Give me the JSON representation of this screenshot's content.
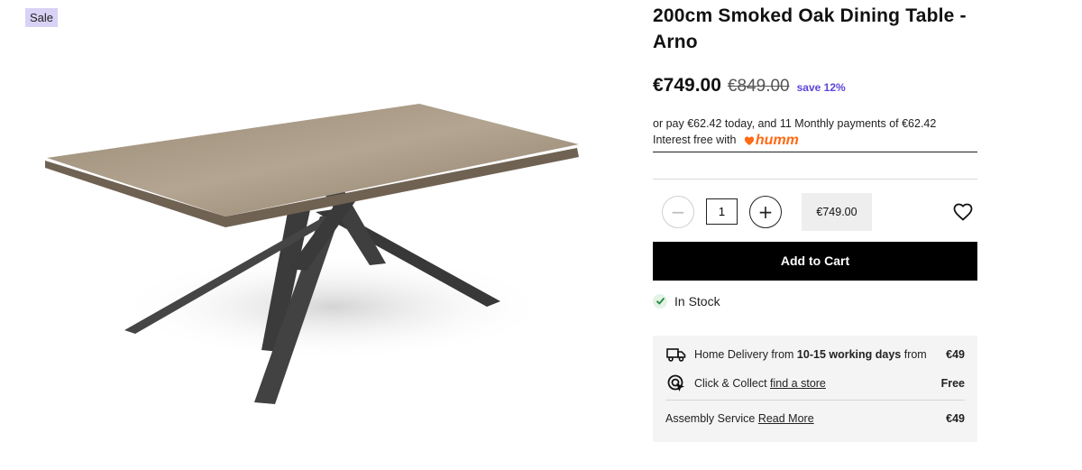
{
  "gallery": {
    "badge": "Sale",
    "slides": [
      {
        "active": true
      },
      {
        "active": false
      },
      {
        "active": false
      },
      {
        "active": false
      },
      {
        "active": false
      },
      {
        "active": false
      }
    ]
  },
  "product": {
    "title": "200cm Smoked Oak Dining Table - Arno",
    "price": "€749.00",
    "was_price": "€849.00",
    "save": "save 12%",
    "finance_line1": "or pay €62.42 today, and 11 Monthly payments of €62.42",
    "finance_line2": "Interest free with",
    "finance_brand": "humm"
  },
  "quantity": {
    "value": "1",
    "line_price": "€749.00"
  },
  "cart": {
    "add_label": "Add to Cart"
  },
  "stock": {
    "label": "In Stock"
  },
  "delivery": {
    "home_prefix": "Home Delivery from ",
    "home_bold": "10-15 working days",
    "home_suffix": " from",
    "home_price": "€49",
    "collect_label": "Click & Collect ",
    "collect_link": "find a store",
    "collect_price": "Free",
    "assembly_label": "Assembly Service ",
    "assembly_link": "Read More",
    "assembly_price": "€49"
  },
  "colors": {
    "accent": "#5b46d9",
    "sale_badge": "#d9d2f5",
    "humm": "#ff6a13"
  }
}
